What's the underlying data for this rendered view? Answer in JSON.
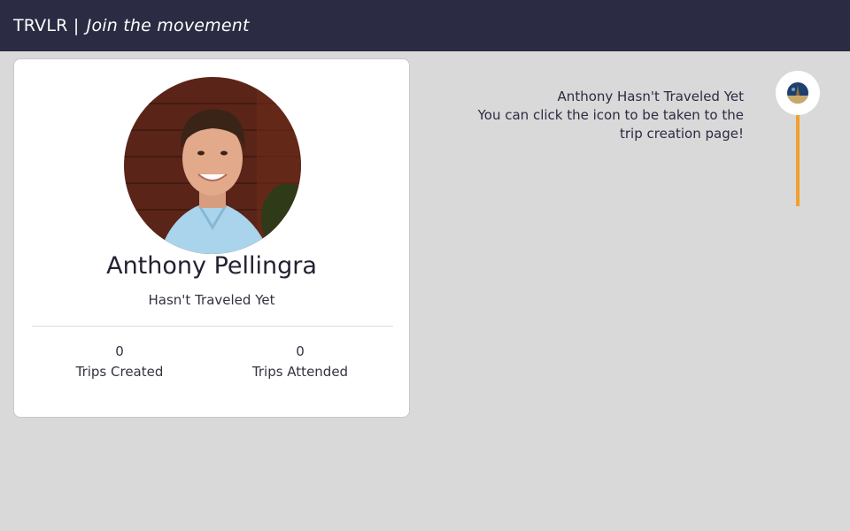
{
  "navbar": {
    "brand": "TRVLR",
    "separator": "|",
    "tagline": "Join the movement"
  },
  "profile": {
    "name": "Anthony Pellingra",
    "status": "Hasn't Traveled Yet",
    "stats": [
      {
        "value": "0",
        "label": "Trips Created"
      },
      {
        "value": "0",
        "label": "Trips Attended"
      }
    ]
  },
  "timeline": {
    "title": "Anthony Hasn't Traveled Yet",
    "message": "You can click the icon to be taken to the trip creation page!",
    "icon": "globe-icon",
    "line_color": "#f0a030"
  },
  "colors": {
    "navbar_bg": "#2b2b43",
    "page_bg": "#d9d9d9",
    "accent": "#f0a030"
  }
}
